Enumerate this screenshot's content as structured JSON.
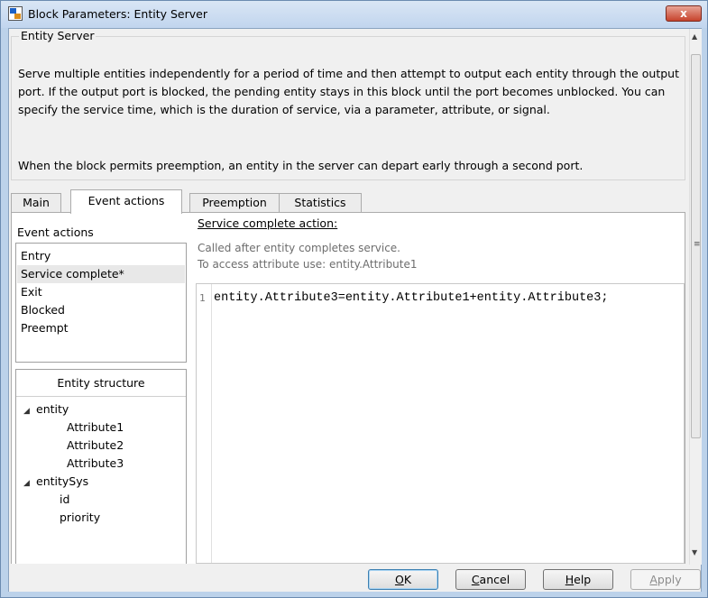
{
  "window": {
    "title": "Block Parameters: Entity Server",
    "close_label": "x"
  },
  "group": {
    "title": "Entity Server",
    "description_1": "Serve multiple entities independently for a period of time and then attempt to output each entity through the output port. If the output port is blocked, the pending entity stays in this block until the port becomes unblocked. You can specify the service time, which is the duration of service, via a parameter, attribute, or signal.",
    "description_2": "When the block permits preemption, an entity in the server can depart early through a second port."
  },
  "tabs": [
    {
      "label": "Main",
      "active": false
    },
    {
      "label": "Event actions",
      "active": true
    },
    {
      "label": "Preemption",
      "active": false
    },
    {
      "label": "Statistics",
      "active": false
    }
  ],
  "event_actions": {
    "label": "Event actions",
    "items": [
      {
        "label": "Entry",
        "selected": false
      },
      {
        "label": "Service complete*",
        "selected": true
      },
      {
        "label": "Exit",
        "selected": false
      },
      {
        "label": "Blocked",
        "selected": false
      },
      {
        "label": "Preempt",
        "selected": false
      }
    ]
  },
  "entity_structure": {
    "header": "Entity structure",
    "tree": [
      {
        "label": "entity",
        "expanded": true,
        "children": [
          "Attribute1",
          "Attribute2",
          "Attribute3"
        ]
      },
      {
        "label": "entitySys",
        "expanded": true,
        "children": [
          "id",
          "priority"
        ]
      }
    ]
  },
  "editor": {
    "title": "Service complete action:",
    "hint_1": "Called after entity completes service.",
    "hint_2": "To access attribute use: entity.Attribute1",
    "line_number": "1",
    "code": "entity.Attribute3=entity.Attribute1+entity.Attribute3;"
  },
  "buttons": {
    "ok": {
      "before": "",
      "mnemonic": "O",
      "after": "K"
    },
    "cancel": {
      "before": "",
      "mnemonic": "C",
      "after": "ancel"
    },
    "help": {
      "before": "",
      "mnemonic": "H",
      "after": "elp"
    },
    "apply": {
      "before": "",
      "mnemonic": "A",
      "after": "pply"
    }
  },
  "icons": {
    "tree_expanded": "◢",
    "scroll_up": "▲",
    "scroll_down": "▼",
    "thumb_grip": "≡"
  },
  "colors": {
    "titlebar": "#c9dbf0",
    "selection": "#e8e8e8",
    "hint_text": "#6d6d6d"
  }
}
